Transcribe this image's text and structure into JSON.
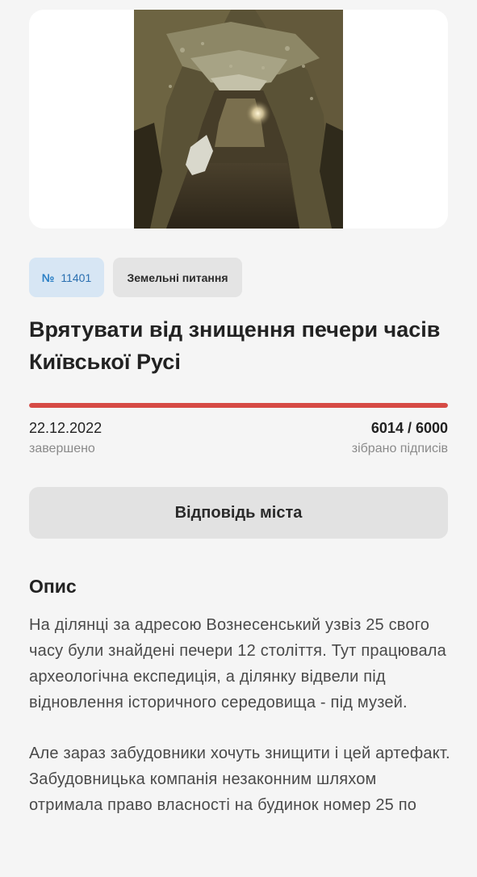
{
  "petition": {
    "number_sign": "№",
    "number": "11401",
    "category": "Земельні питання",
    "title": "Врятувати від знищення печери часів Київської Русі",
    "date": "22.12.2022",
    "status": "завершено",
    "signatures": "6014 / 6000",
    "signatures_caption": "зібрано підписів",
    "progress_fraction": 1.0,
    "progress_color": "#d64b45"
  },
  "actions": {
    "response_button": "Відповідь міста"
  },
  "description": {
    "heading": "Опис",
    "paragraph_1": "На ділянці за адресою Вознесенський узвіз 25 свого часу були знайдені печери 12 століття. Тут працювала археологічна експедиція, а ділянку відвели під відновлення історичного середовища - під музей.",
    "paragraph_2": "Але зараз забудовники хочуть знищити і цей артефакт. Забудовницька компанія незаконним шляхом отримала право власності на будинок номер 25 по"
  },
  "image": {
    "subject": "cave-tunnel-photo"
  }
}
